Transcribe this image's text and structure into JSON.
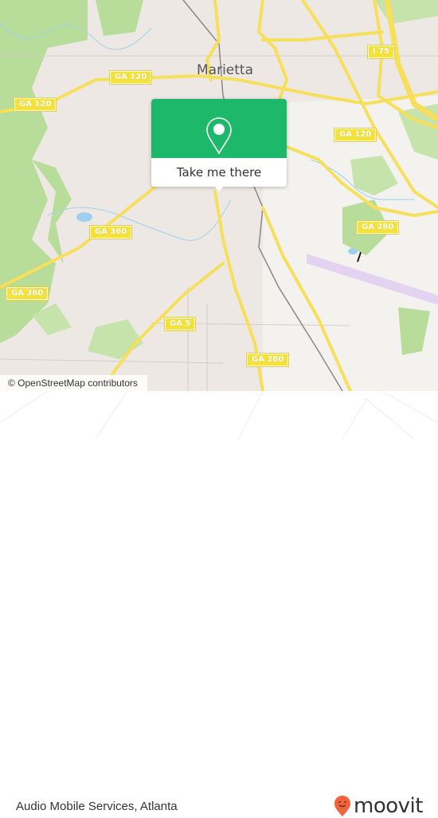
{
  "map": {
    "city_label": "Marietta",
    "road_shields": [
      {
        "id": "ga120-west",
        "label": "GA 120"
      },
      {
        "id": "ga120-center",
        "label": "GA 120"
      },
      {
        "id": "ga120-east",
        "label": "GA 120"
      },
      {
        "id": "i75",
        "label": "I 75"
      },
      {
        "id": "ga280-east",
        "label": "GA 280"
      },
      {
        "id": "ga360-center",
        "label": "GA 360"
      },
      {
        "id": "ga360-west",
        "label": "GA 360"
      },
      {
        "id": "ga5",
        "label": "GA 5"
      },
      {
        "id": "ga280-south",
        "label": "GA 280"
      }
    ],
    "attribution": "© OpenStreetMap contributors",
    "colors": {
      "land": "#eee8e4",
      "park": "#b8dd9a",
      "water": "#9ed0ee",
      "road": "#f6df5a",
      "runway": "#e3d3f0"
    }
  },
  "popup": {
    "icon": "map-pin-icon",
    "button_label": "Take me there",
    "color": "#1db86a"
  },
  "footer": {
    "place_name": "Audio Mobile Services, Atlanta",
    "brand": "moovit",
    "brand_color": "#f0643c"
  }
}
